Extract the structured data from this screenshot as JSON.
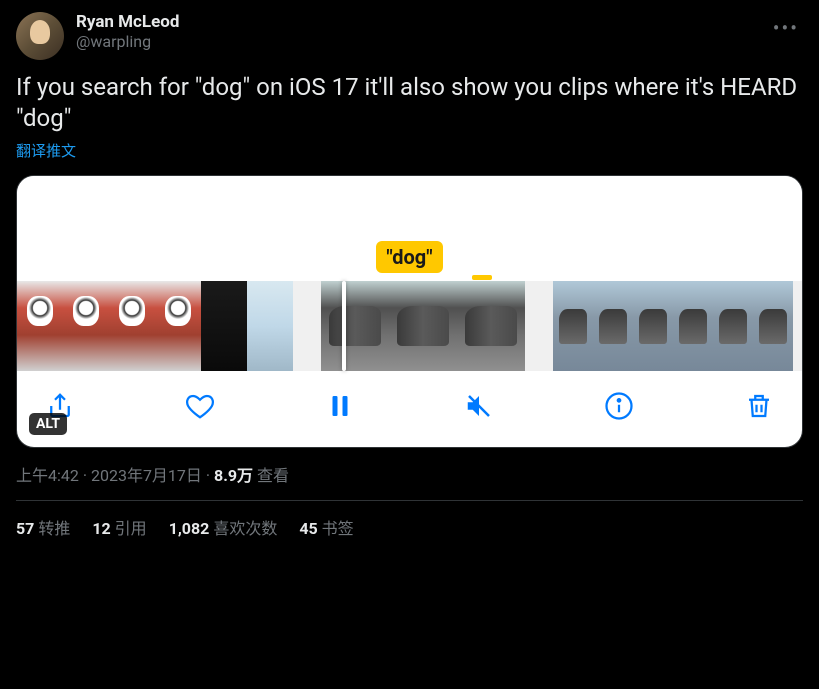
{
  "author": {
    "display_name": "Ryan McLeod",
    "handle": "@warpling"
  },
  "body_text": "If you search for \"dog\" on iOS 17 it'll also show you clips where it's HEARD \"dog\"",
  "translate_label": "翻译推文",
  "media": {
    "search_badge": "\"dog\"",
    "alt_badge": "ALT"
  },
  "timestamp": "上午4:42 · 2023年7月17日",
  "views": {
    "count": "8.9万",
    "label": "查看"
  },
  "stats": {
    "retweets": {
      "count": "57",
      "label": "转推"
    },
    "quotes": {
      "count": "12",
      "label": "引用"
    },
    "likes": {
      "count": "1,082",
      "label": "喜欢次数"
    },
    "bookmarks": {
      "count": "45",
      "label": "书签"
    }
  }
}
